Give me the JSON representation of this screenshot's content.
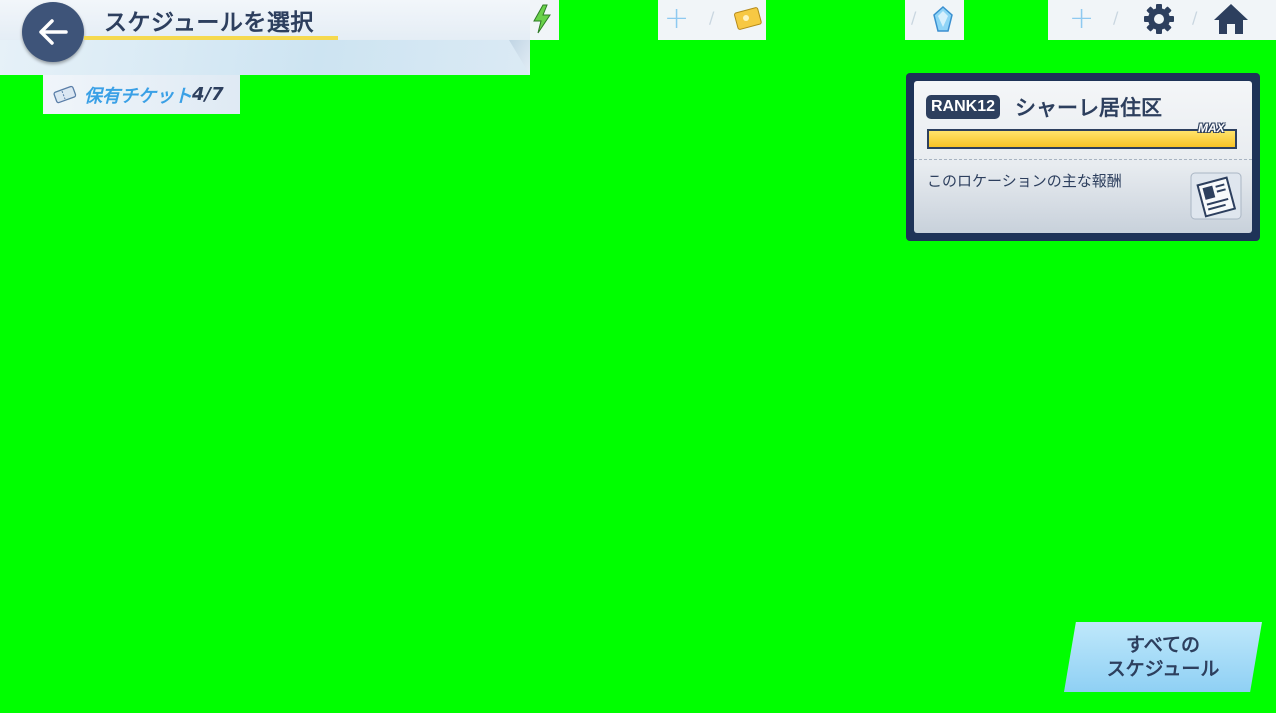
{
  "header": {
    "title": "スケジュールを選択",
    "back_icon": "back-arrow-icon"
  },
  "topbar": {
    "ap_icon": "lightning-icon",
    "credit_icon": "credit-card-icon",
    "gem_icon": "blue-gem-icon",
    "plus_symbol": "+",
    "settings_icon": "gear-icon",
    "home_icon": "home-icon"
  },
  "ticket": {
    "icon": "ticket-icon",
    "label": "保有チケット",
    "count": "4/7"
  },
  "location": {
    "rank_label": "RANK12",
    "name": "シャーレ居住区",
    "progress": 1.0,
    "max_label": "MAX",
    "reward_label": "このロケーションの主な報酬",
    "reward_icon": "report-item-icon"
  },
  "all_schedules": {
    "line1": "すべての",
    "line2": "スケジュール"
  },
  "colors": {
    "navy": "#2d3f5e",
    "accent_yellow": "#f8c326",
    "accent_blue": "#3aa0e6",
    "chroma_green": "#00ff00"
  }
}
